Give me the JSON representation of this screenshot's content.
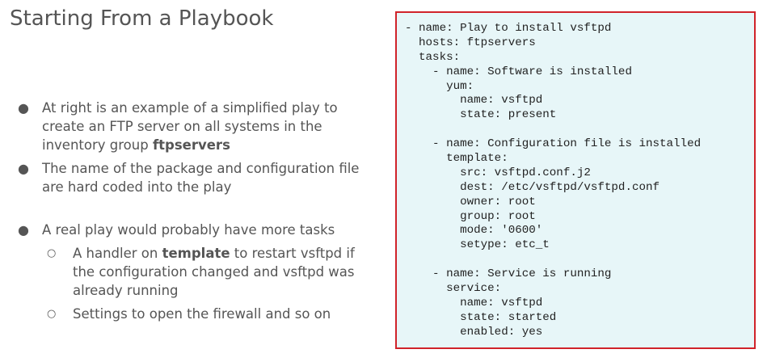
{
  "title": "Starting From a Playbook",
  "bullets": {
    "b1_pre": "At right is an example of a simplified play to create an FTP server on all systems in the inventory group ",
    "b1_strong": "ftpservers",
    "b2": "The name of the package and configuration file are hard coded into the play",
    "b3": "A real play would probably have more tasks",
    "sub1_pre": "A handler on ",
    "sub1_strong": "template",
    "sub1_post": " to restart vsftpd if the configuration changed and vsftpd was already running",
    "sub2": "Settings to open the firewall and so on"
  },
  "code_lines": [
    "- name: Play to install vsftpd",
    "  hosts: ftpservers",
    "  tasks:",
    "    - name: Software is installed",
    "      yum:",
    "        name: vsftpd",
    "        state: present",
    "",
    "    - name: Configuration file is installed",
    "      template:",
    "        src: vsftpd.conf.j2",
    "        dest: /etc/vsftpd/vsftpd.conf",
    "        owner: root",
    "        group: root",
    "        mode: '0600'",
    "        setype: etc_t",
    "",
    "    - name: Service is running",
    "      service:",
    "        name: vsftpd",
    "        state: started",
    "        enabled: yes"
  ],
  "colors": {
    "code_border": "#d0232a",
    "code_background": "#e7f6f8",
    "text": "#555555"
  }
}
